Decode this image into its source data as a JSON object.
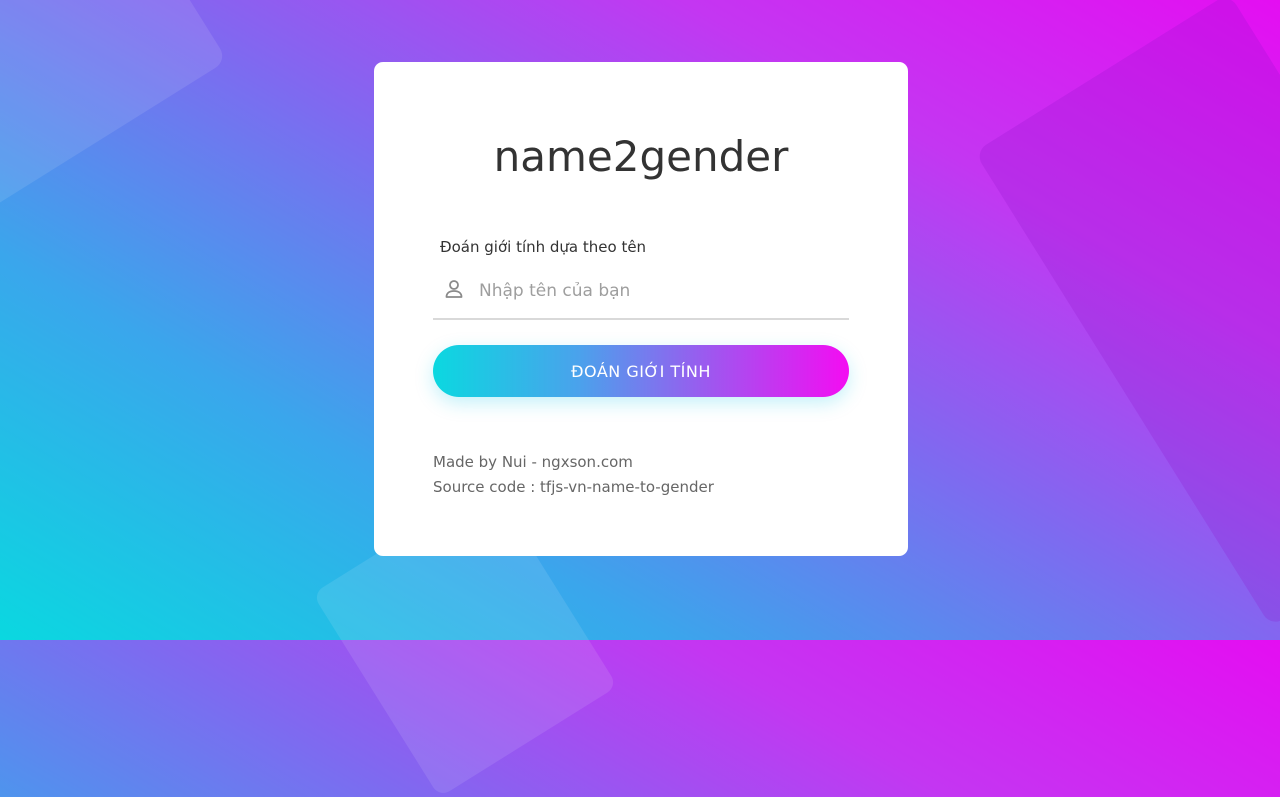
{
  "app": {
    "title": "name2gender"
  },
  "form": {
    "label": "Đoán giới tính dựa theo tên",
    "input": {
      "placeholder": "Nhập tên của bạn",
      "value": "",
      "icon": "user-icon"
    },
    "submit_label": "ĐOÁN GIỚI TÍNH"
  },
  "footer": {
    "made_by": "Made by Nui - ngxson.com",
    "source_code": "Source code : tfjs-vn-name-to-gender"
  },
  "colors": {
    "gradient_start": "#0bd8e0",
    "gradient_end": "#f40cf2",
    "card_background": "#ffffff",
    "title_text": "#333333"
  }
}
